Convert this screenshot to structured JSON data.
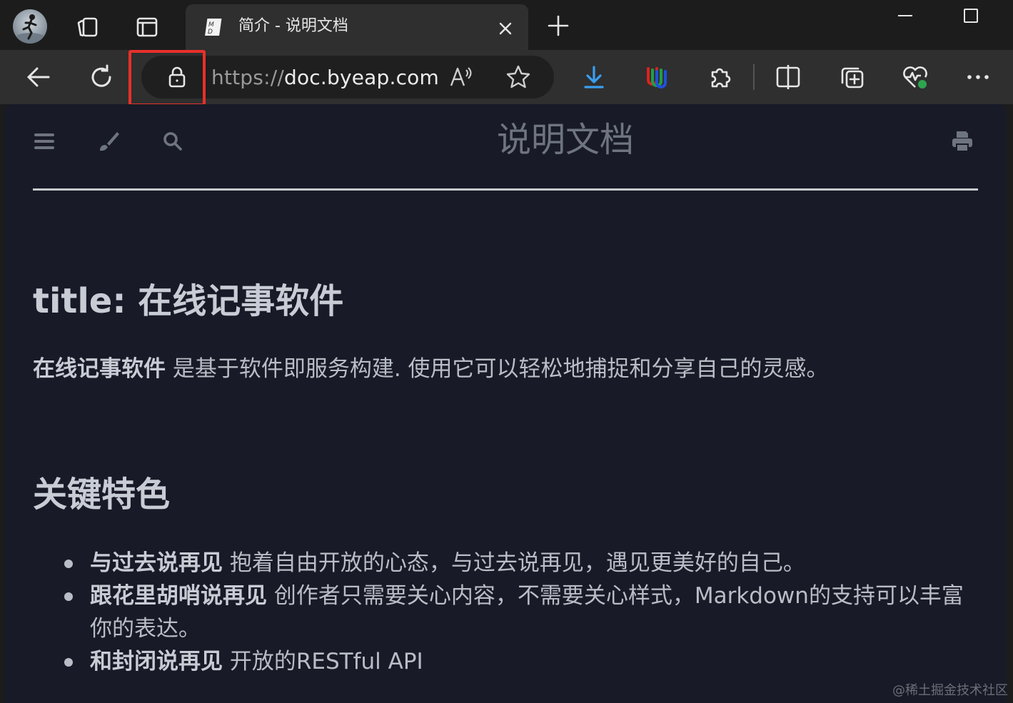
{
  "browser": {
    "tab": {
      "title": "简介 - 说明文档",
      "favicon": "markdown-icon"
    },
    "url": {
      "scheme": "https://",
      "host": "doc.byeap.com"
    },
    "icons": [
      "profile-avatar",
      "workspaces-icon",
      "vertical-tabs-icon",
      "close-icon",
      "plus-icon",
      "minimize-icon",
      "maximize-icon",
      "back-icon",
      "refresh-icon",
      "lock-icon",
      "read-aloud-icon",
      "star-icon",
      "download-icon",
      "extension-u-icon",
      "puzzle-icon",
      "split-screen-icon",
      "collections-icon",
      "browser-essentials-icon",
      "more-icon"
    ],
    "highlight_color": "#e8302a"
  },
  "toolbar": {
    "icons": [
      "menu-icon",
      "brush-icon",
      "search-icon",
      "print-icon"
    ],
    "book_title": "说明文档"
  },
  "content": {
    "h1": "title: 在线记事软件",
    "para_bold": "在线记事软件",
    "para_text": " 是基于软件即服务构建. 使用它可以轻松地捕捉和分享自己的灵感。",
    "h2": "关键特色",
    "features": [
      {
        "bold": "与过去说再见",
        "text": " 抱着自由开放的心态，与过去说再见，遇见更美好的自己。"
      },
      {
        "bold": "跟花里胡哨说再见",
        "text": " 创作者只需要关心内容，不需要关心样式，Markdown的支持可以丰富你的表达。"
      },
      {
        "bold": "和封闭说再见",
        "text": " 开放的RESTful API"
      }
    ]
  },
  "watermark": "@稀土掘金技术社区",
  "colors": {
    "page_bg": "#181b27",
    "chrome_bg": "#2f2f2f",
    "titlebar_bg": "#1c1c1c"
  }
}
